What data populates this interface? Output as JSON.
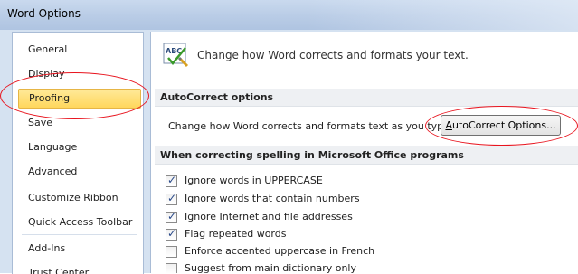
{
  "window": {
    "title": "Word Options"
  },
  "sidebar": {
    "items": [
      {
        "label": "General",
        "selected": false
      },
      {
        "label": "Display",
        "selected": false
      },
      {
        "label": "Proofing",
        "selected": true
      },
      {
        "label": "Save",
        "selected": false
      },
      {
        "label": "Language",
        "selected": false
      },
      {
        "label": "Advanced",
        "selected": false
      },
      {
        "label": "Customize Ribbon",
        "selected": false
      },
      {
        "label": "Quick Access Toolbar",
        "selected": false
      },
      {
        "label": "Add-Ins",
        "selected": false
      },
      {
        "label": "Trust Center",
        "selected": false
      }
    ]
  },
  "header": {
    "text": "Change how Word corrects and formats your text.",
    "icon": "abc-check-icon"
  },
  "autocorrect": {
    "section_title": "AutoCorrect options",
    "description": "Change how Word corrects and formats text as you type:",
    "button_label": "AutoCorrect Options..."
  },
  "spelling": {
    "section_title": "When correcting spelling in Microsoft Office programs",
    "options": [
      {
        "label": "Ignore words in UPPERCASE",
        "checked": true
      },
      {
        "label": "Ignore words that contain numbers",
        "checked": true
      },
      {
        "label": "Ignore Internet and file addresses",
        "checked": true
      },
      {
        "label": "Flag repeated words",
        "checked": true
      },
      {
        "label": "Enforce accented uppercase in French",
        "checked": false
      },
      {
        "label": "Suggest from main dictionary only",
        "checked": false
      }
    ]
  },
  "annotations": {
    "highlight_color": "#e8141e"
  }
}
